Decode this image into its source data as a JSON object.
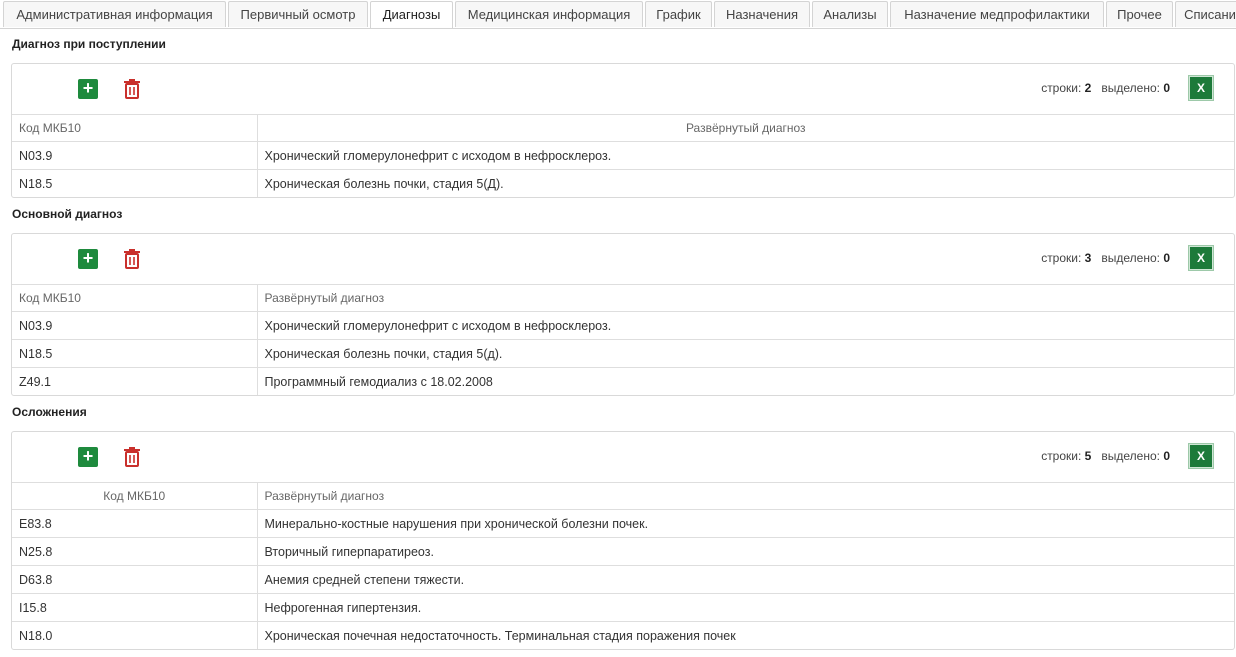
{
  "tabs": [
    "Административная информация",
    "Первичный осмотр",
    "Диагнозы",
    "Медицинская информация",
    "График",
    "Назначения",
    "Анализы",
    "Назначение медпрофилактики",
    "Прочее",
    "Списани"
  ],
  "active_tab": "Диагнозы",
  "labels": {
    "rows": "строки:",
    "selected": "выделено:",
    "excel": "X",
    "add": "+"
  },
  "sections": [
    {
      "title": "Диагноз при поступлении",
      "rows_count": "2",
      "selected_count": "0",
      "headers": [
        "Код МКБ10",
        "Развёрнутый диагноз"
      ],
      "rows": [
        [
          "N03.9",
          "Хронический гломерулонефрит с исходом в нефросклероз."
        ],
        [
          "N18.5",
          "Хроническая болезнь почки, стадия 5(Д)."
        ]
      ]
    },
    {
      "title": "Основной диагноз",
      "rows_count": "3",
      "selected_count": "0",
      "headers": [
        "Код МКБ10",
        "Развёрнутый диагноз"
      ],
      "rows": [
        [
          "N03.9",
          "Хронический гломерулонефрит с исходом в нефросклероз."
        ],
        [
          "N18.5",
          "Хроническая болезнь почки, стадия 5(д)."
        ],
        [
          "Z49.1",
          "Программный гемодиализ с 18.02.2008"
        ]
      ]
    },
    {
      "title": "Осложнения",
      "rows_count": "5",
      "selected_count": "0",
      "headers": [
        "Код МКБ10",
        "Развёрнутый диагноз"
      ],
      "rows": [
        [
          "E83.8",
          "Минерально-костные нарушения при хронической болезни почек."
        ],
        [
          "N25.8",
          "Вторичный гиперпаратиреоз."
        ],
        [
          "D63.8",
          "Анемия средней степени тяжести."
        ],
        [
          "I15.8",
          "Нефрогенная гипертензия."
        ],
        [
          "N18.0",
          "Хроническая почечная недостаточность. Терминальная стадия поражения почек"
        ]
      ]
    }
  ]
}
